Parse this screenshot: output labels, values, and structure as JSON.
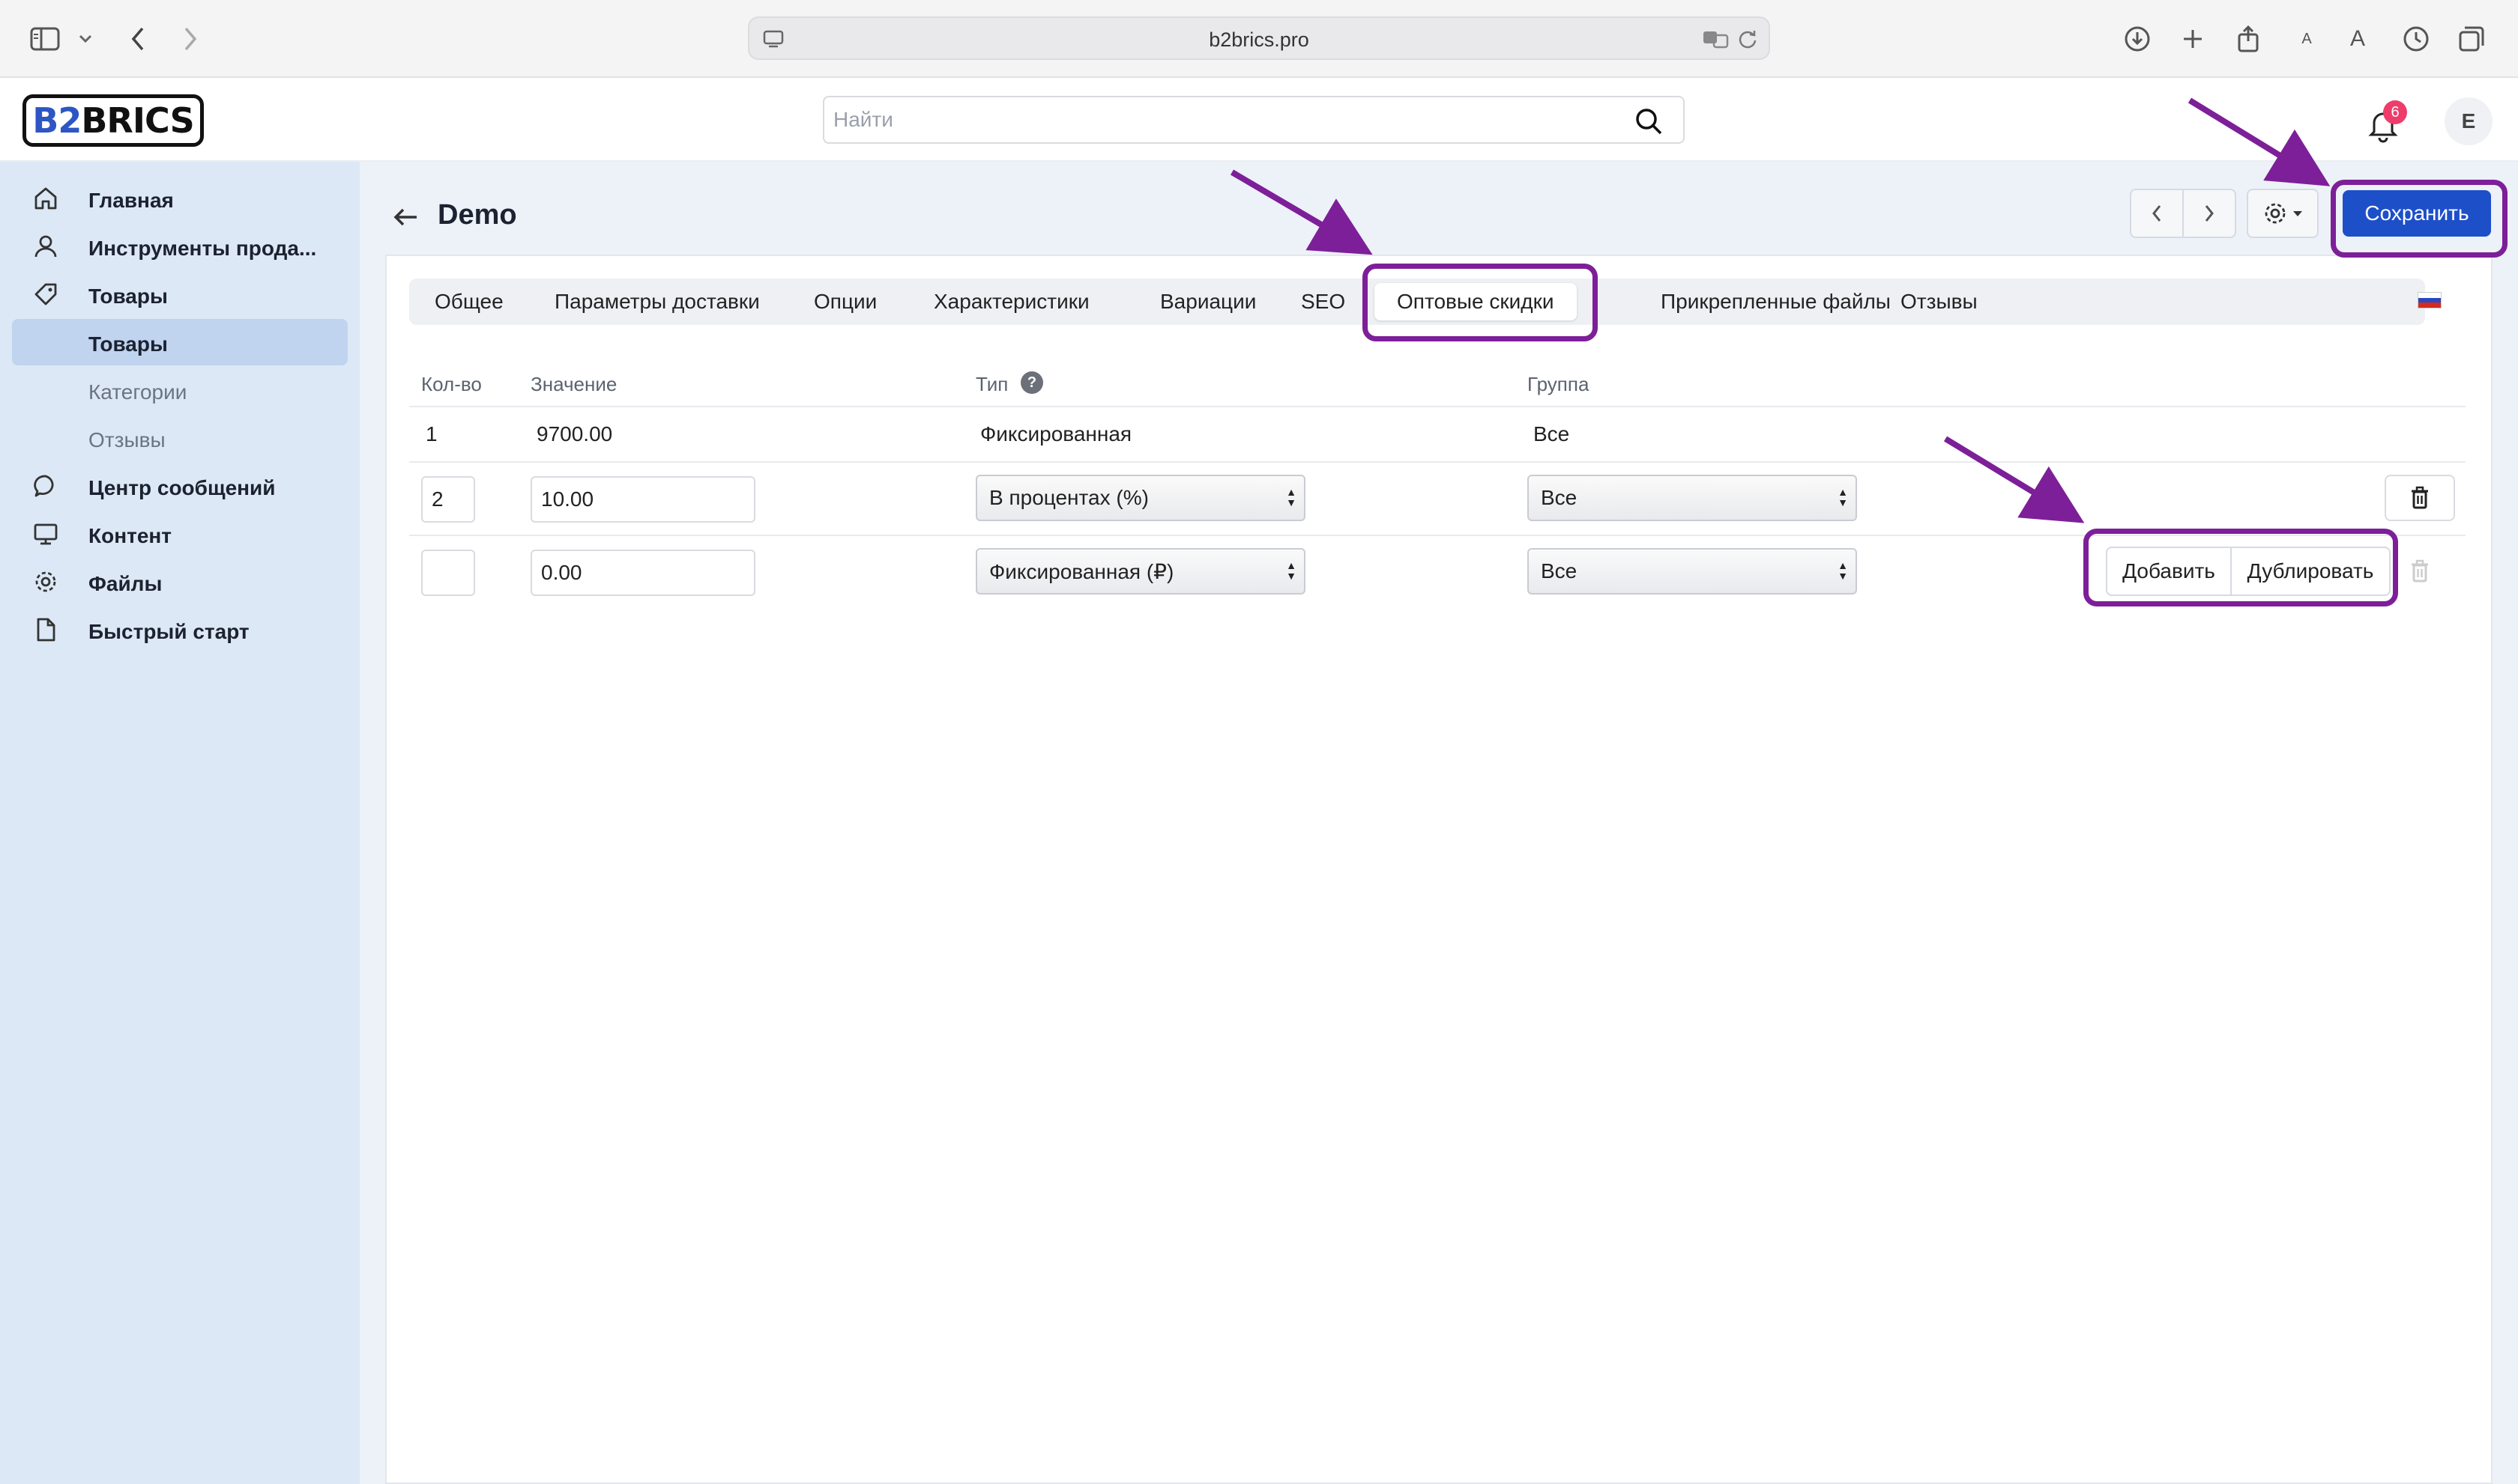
{
  "browser": {
    "url": "b2brics.pro"
  },
  "header": {
    "logo_b2": "B2",
    "logo_brics": "BRICS",
    "search_placeholder": "Найти",
    "notifications_count": "6",
    "avatar_initial": "E"
  },
  "sidebar": {
    "items": [
      {
        "label": "Главная",
        "icon": "home-icon"
      },
      {
        "label": "Инструменты прода...",
        "icon": "user-icon"
      },
      {
        "label": "Товары",
        "icon": "tag-icon"
      },
      {
        "label": "Товары",
        "icon": ""
      },
      {
        "label": "Категории",
        "icon": ""
      },
      {
        "label": "Отзывы",
        "icon": ""
      },
      {
        "label": "Центр сообщений",
        "icon": "chat-icon"
      },
      {
        "label": "Контент",
        "icon": "monitor-icon"
      },
      {
        "label": "Файлы",
        "icon": "gear-icon"
      },
      {
        "label": "Быстрый старт",
        "icon": "file-icon"
      }
    ],
    "active_index": 3
  },
  "page": {
    "title": "Demo",
    "save_label": "Сохранить"
  },
  "tabs": [
    "Общее",
    "Параметры доставки",
    "Опции",
    "Характеристики",
    "Вариации",
    "SEO",
    "Оптовые скидки",
    "Прикрепленные файлы",
    "Отзывы"
  ],
  "active_tab": "Оптовые скидки",
  "table": {
    "headers": {
      "qty": "Кол-во",
      "value": "Значение",
      "type": "Тип",
      "group": "Группа"
    },
    "base_row": {
      "qty": "1",
      "value": "9700.00",
      "type": "Фиксированная",
      "group": "Все"
    },
    "rows": [
      {
        "qty": "2",
        "value": "10.00",
        "type": "В процентах (%)",
        "group": "Все"
      },
      {
        "qty": "",
        "value": "0.00",
        "type": "Фиксированная (₽)",
        "group": "Все"
      }
    ],
    "add_label": "Добавить",
    "duplicate_label": "Дублировать"
  },
  "colors": {
    "accent": "#1d4fc9",
    "annotation": "#7d1f98",
    "sidebar_bg": "#dde8f6",
    "badge": "#ee3d6b"
  }
}
